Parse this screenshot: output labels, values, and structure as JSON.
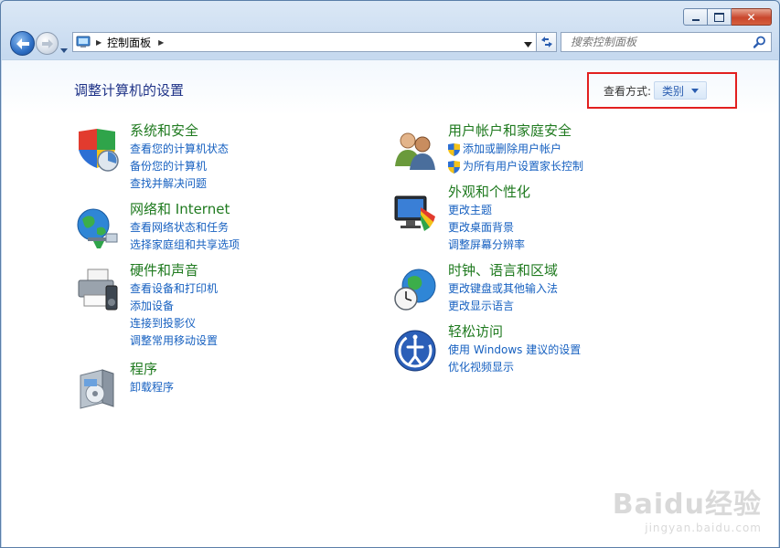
{
  "window": {
    "breadcrumb": "控制面板",
    "search_placeholder": "搜索控制面板"
  },
  "content": {
    "title": "调整计算机的设置",
    "view_by_label": "查看方式:",
    "view_by_value": "类别"
  },
  "categories": {
    "system": {
      "title": "系统和安全",
      "links": [
        "查看您的计算机状态",
        "备份您的计算机",
        "查找并解决问题"
      ]
    },
    "network": {
      "title": "网络和 Internet",
      "links": [
        "查看网络状态和任务",
        "选择家庭组和共享选项"
      ]
    },
    "hardware": {
      "title": "硬件和声音",
      "links": [
        "查看设备和打印机",
        "添加设备",
        "连接到投影仪",
        "调整常用移动设置"
      ]
    },
    "programs": {
      "title": "程序",
      "links": [
        "卸载程序"
      ]
    },
    "users": {
      "title": "用户帐户和家庭安全",
      "links": [
        "添加或删除用户帐户",
        "为所有用户设置家长控制"
      ]
    },
    "appearance": {
      "title": "外观和个性化",
      "links": [
        "更改主题",
        "更改桌面背景",
        "调整屏幕分辨率"
      ]
    },
    "clock": {
      "title": "时钟、语言和区域",
      "links": [
        "更改键盘或其他输入法",
        "更改显示语言"
      ]
    },
    "ease": {
      "title": "轻松访问",
      "links": [
        "使用 Windows 建议的设置",
        "优化视频显示"
      ]
    }
  },
  "watermark": {
    "brand": "Baidu经验",
    "url": "jingyan.baidu.com"
  },
  "colors": {
    "link": "#1660c0",
    "category_title": "#1f7a1f",
    "page_title": "#1e3287",
    "highlight_box": "#e21f1f"
  }
}
